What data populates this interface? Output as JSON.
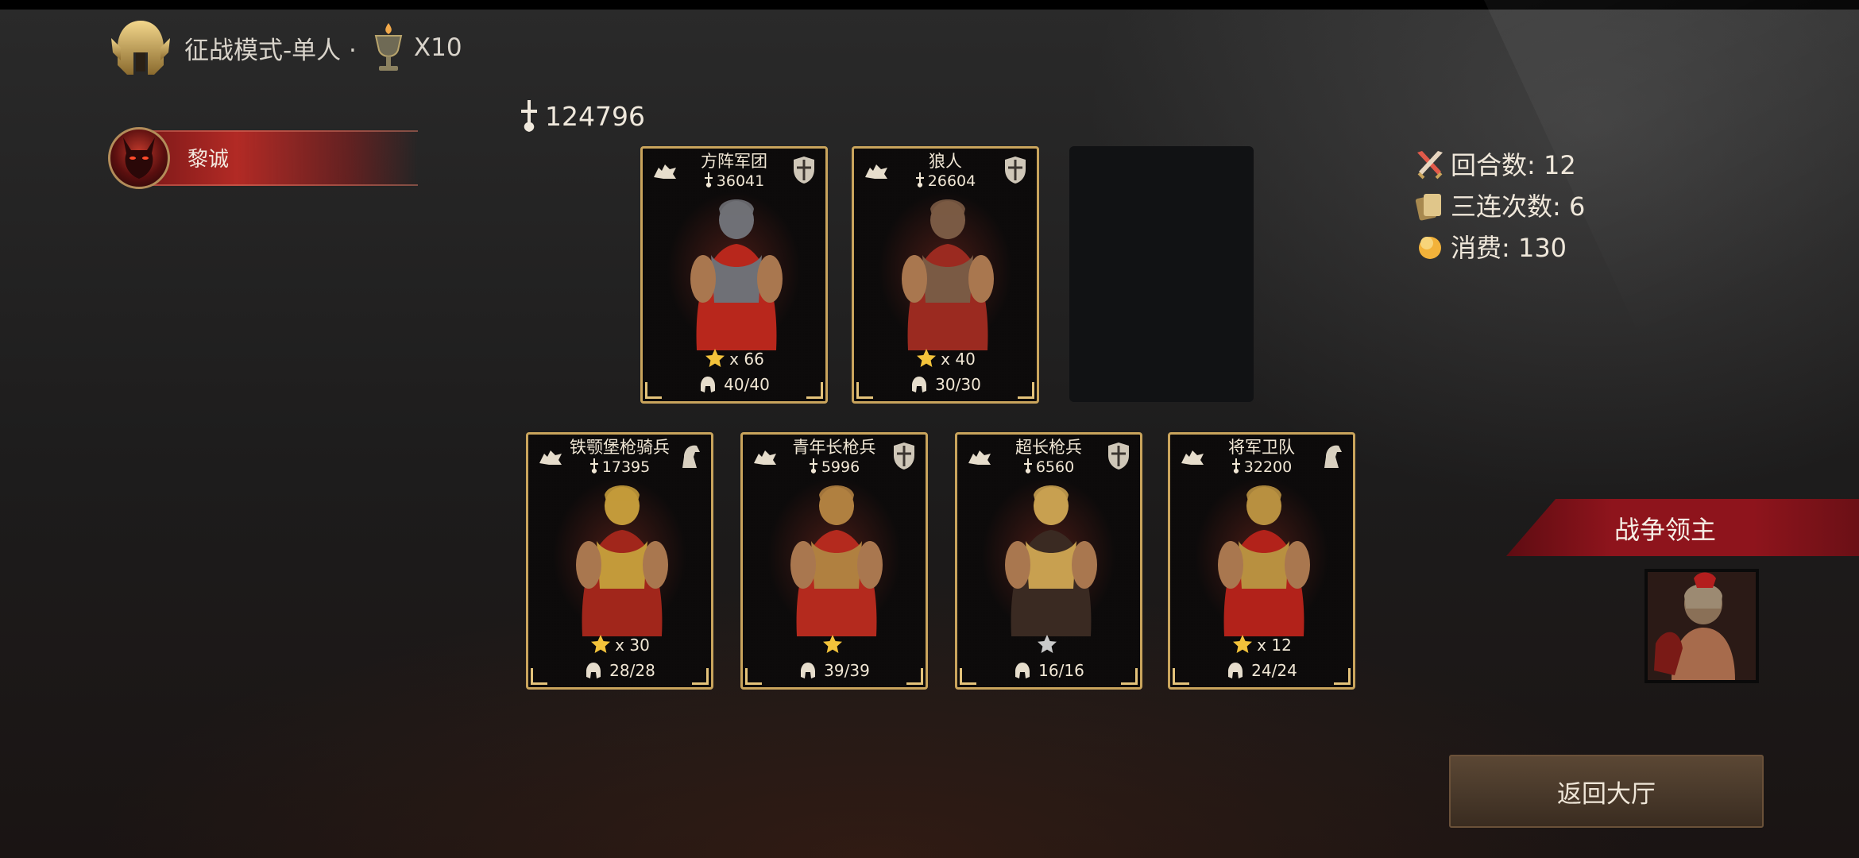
{
  "header": {
    "mode": "征战模式-单人 ·",
    "multiplier": "X10",
    "helmet_icon": "helmet-icon",
    "cup_icon": "chalice-icon"
  },
  "player": {
    "name": "黎诚",
    "avatar_icon": "demon-avatar"
  },
  "power": {
    "total": "124796",
    "icon": "power-icon"
  },
  "cards_top": [
    {
      "name": "方阵军团",
      "power": "36041",
      "stars": "x 66",
      "troops": "40/40",
      "type_icon": "shield-icon",
      "star_color": "gold"
    },
    {
      "name": "狼人",
      "power": "26604",
      "stars": "x 40",
      "troops": "30/30",
      "type_icon": "shield-icon",
      "star_color": "gold"
    }
  ],
  "cards_bottom": [
    {
      "name": "铁颚堡枪骑兵",
      "power": "17395",
      "stars": "x 30",
      "troops": "28/28",
      "type_icon": "horse-icon",
      "star_color": "gold"
    },
    {
      "name": "青年长枪兵",
      "power": "5996",
      "stars": "",
      "troops": "39/39",
      "type_icon": "shield-icon",
      "star_color": "gold"
    },
    {
      "name": "超长枪兵",
      "power": "6560",
      "stars": "",
      "troops": "16/16",
      "type_icon": "shield-icon",
      "star_color": "silver"
    },
    {
      "name": "将军卫队",
      "power": "32200",
      "stars": "x 12",
      "troops": "24/24",
      "type_icon": "horse-icon",
      "star_color": "gold"
    }
  ],
  "stats": {
    "rounds": "回合数: 12",
    "triple": "三连次数: 6",
    "cost": "消费: 130"
  },
  "warlord": {
    "title": "战争领主"
  },
  "buttons": {
    "return": "返回大厅"
  },
  "colors": {
    "gold": "#c9a45c",
    "banner_red": "#8e141c",
    "player_red": "#b22a25",
    "button_brown": "#4a3a2b"
  }
}
